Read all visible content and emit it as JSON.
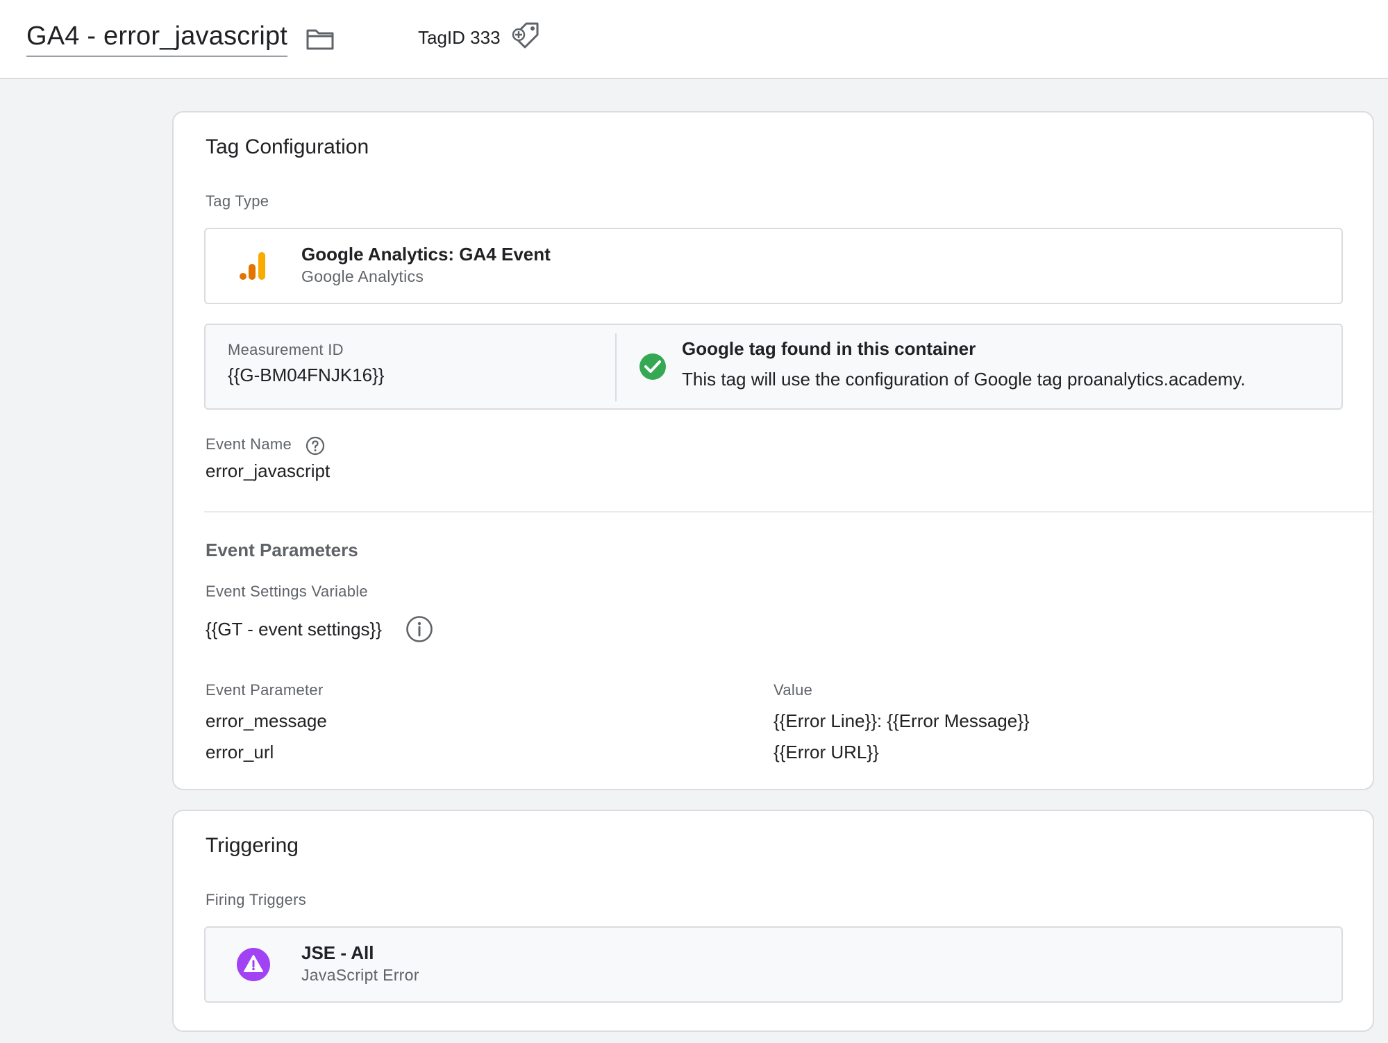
{
  "header": {
    "tag_name": "GA4 - error_javascript",
    "tag_id_label": "TagID 333",
    "folder_icon": "folder-icon",
    "tag_icon": "tag-add-icon"
  },
  "tag_configuration": {
    "title": "Tag Configuration",
    "tag_type_label": "Tag Type",
    "tag_type": {
      "name": "Google Analytics: GA4 Event",
      "provider": "Google Analytics",
      "icon": "google-analytics-icon",
      "icon_colors": [
        "#e37400",
        "#f9ab00"
      ]
    },
    "measurement": {
      "label": "Measurement ID",
      "value": "{{G-BM04FNJK16}}",
      "status_title": "Google tag found in this container",
      "status_text": "This tag will use the configuration of Google tag proanalytics.academy.",
      "status_icon": "check-circle-icon",
      "status_color": "#34a853"
    },
    "event_name": {
      "label": "Event Name",
      "value": "error_javascript",
      "help_icon": "help-icon"
    },
    "event_parameters": {
      "section_title": "Event Parameters",
      "settings_variable_label": "Event Settings Variable",
      "settings_variable_value": "{{GT - event settings}}",
      "info_icon": "info-icon",
      "columns": [
        "Event Parameter",
        "Value"
      ],
      "rows": [
        {
          "parameter": "error_message",
          "value": "{{Error Line}}: {{Error Message}}"
        },
        {
          "parameter": "error_url",
          "value": "{{Error URL}}"
        }
      ]
    }
  },
  "triggering": {
    "title": "Triggering",
    "firing_label": "Firing Triggers",
    "trigger": {
      "name": "JSE - All",
      "type": "JavaScript Error",
      "icon": "warning-icon",
      "icon_color": "#a142f4"
    }
  }
}
